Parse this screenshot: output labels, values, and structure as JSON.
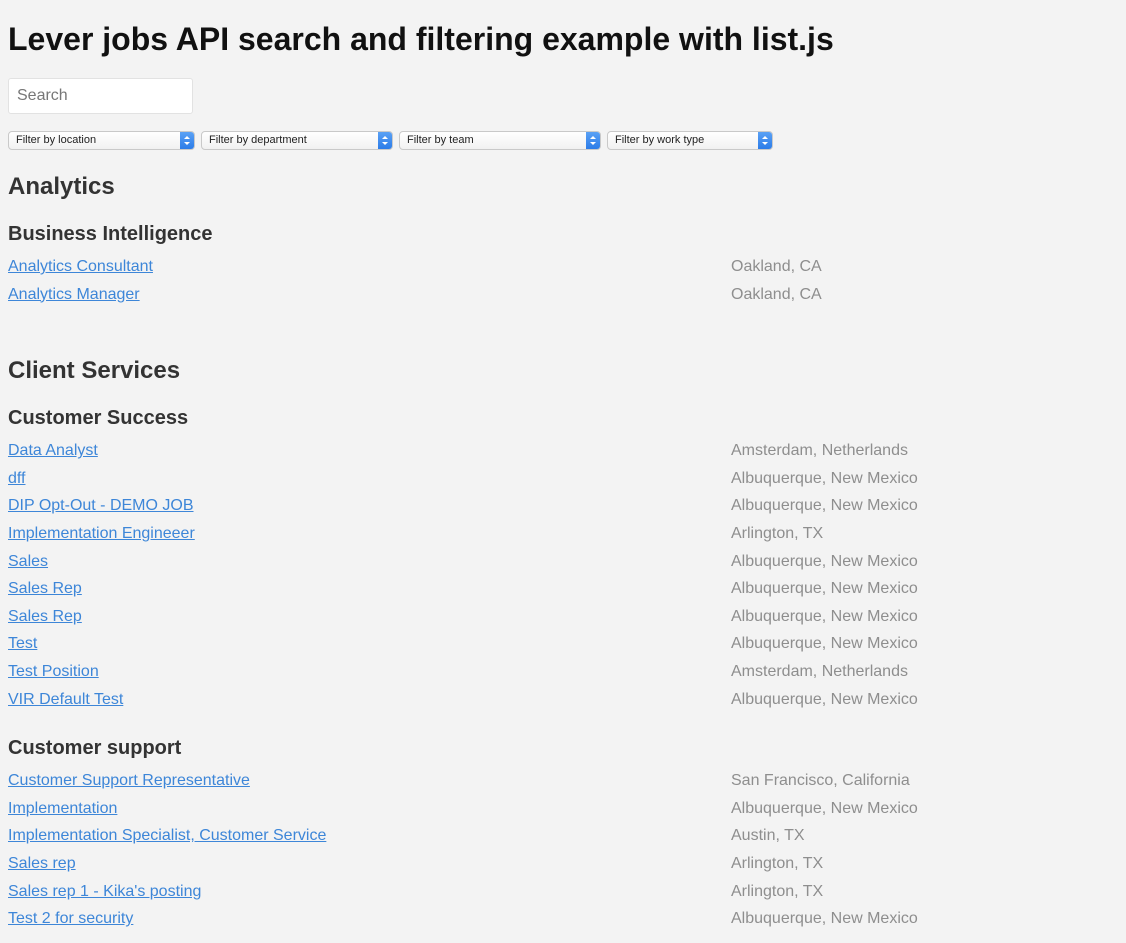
{
  "header": {
    "title": "Lever jobs API search and filtering example with list.js"
  },
  "search": {
    "placeholder": "Search",
    "value": ""
  },
  "filters": [
    {
      "label": "Filter by location"
    },
    {
      "label": "Filter by department"
    },
    {
      "label": "Filter by team"
    },
    {
      "label": "Filter by work type"
    }
  ],
  "departments": [
    {
      "name": "Analytics",
      "teams": [
        {
          "name": "Business Intelligence",
          "postings": [
            {
              "title": "Analytics Consultant",
              "location": "Oakland, CA"
            },
            {
              "title": "Analytics Manager",
              "location": "Oakland, CA"
            }
          ]
        }
      ]
    },
    {
      "name": "Client Services",
      "teams": [
        {
          "name": "Customer Success",
          "postings": [
            {
              "title": "Data Analyst",
              "location": "Amsterdam, Netherlands"
            },
            {
              "title": "dff",
              "location": "Albuquerque, New Mexico"
            },
            {
              "title": "DIP Opt-Out - DEMO JOB",
              "location": "Albuquerque, New Mexico"
            },
            {
              "title": "Implementation Engineeer",
              "location": "Arlington, TX"
            },
            {
              "title": "Sales",
              "location": "Albuquerque, New Mexico"
            },
            {
              "title": "Sales Rep",
              "location": "Albuquerque, New Mexico"
            },
            {
              "title": "Sales Rep",
              "location": "Albuquerque, New Mexico"
            },
            {
              "title": "Test",
              "location": "Albuquerque, New Mexico"
            },
            {
              "title": "Test Position",
              "location": "Amsterdam, Netherlands"
            },
            {
              "title": "VIR Default Test",
              "location": "Albuquerque, New Mexico"
            }
          ]
        },
        {
          "name": "Customer support",
          "postings": [
            {
              "title": "Customer Support Representative",
              "location": "San Francisco, California"
            },
            {
              "title": "Implementation",
              "location": "Albuquerque, New Mexico"
            },
            {
              "title": "Implementation Specialist, Customer Service",
              "location": "Austin, TX"
            },
            {
              "title": "Sales rep",
              "location": "Arlington, TX"
            },
            {
              "title": "Sales rep 1 - Kika's posting",
              "location": "Arlington, TX"
            },
            {
              "title": "Test 2 for security",
              "location": "Albuquerque, New Mexico"
            }
          ]
        }
      ]
    }
  ]
}
